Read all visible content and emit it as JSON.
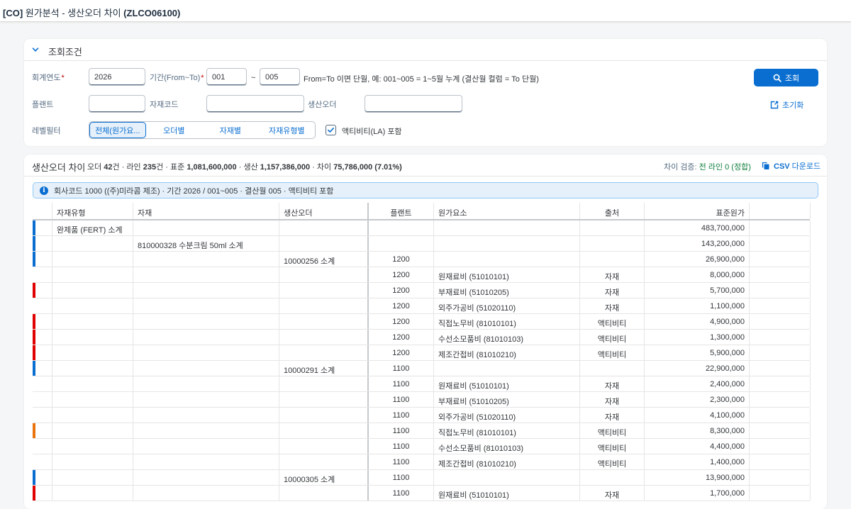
{
  "app": {
    "title_code": "[CO]",
    "title_text": " 원가분석 - 생산오더 차이 ",
    "title_tcode": "(ZLCO06100)"
  },
  "filters": {
    "title": "조회조건",
    "fiscal_year": {
      "label": "회계연도",
      "value": "2026"
    },
    "period": {
      "label": "기간(From~To)",
      "from": "001",
      "separator": "~",
      "to": "005",
      "hint": "From=To 이면 단월, 예: 001~005 = 1~5월 누계 (결산월 컬럼 = To 단월)"
    },
    "plant": {
      "label": "플랜트",
      "value": ""
    },
    "material_code": {
      "label": "자재코드",
      "value": ""
    },
    "production_order": {
      "label": "생산오더",
      "value": ""
    },
    "level_filter": {
      "label": "레벨필터",
      "options": [
        "전체(원가요...",
        "오더별",
        "자재별",
        "자재유형별"
      ],
      "selected": 0
    },
    "activity_checkbox": {
      "label": "액티비티(LA) 포함",
      "checked": true
    },
    "search_button": "조회",
    "reset_button": "초기화"
  },
  "results": {
    "title": "생산오더 차이",
    "summary": {
      "p1": "오더 ",
      "orders": "42",
      "p2": "건 · 라인 ",
      "lines": "235",
      "p3": "건 · 표준 ",
      "std": "1,081,600,000",
      "p4": " · 생산 ",
      "prod": "1,157,386,000",
      "p5": " · 차이 ",
      "diff": "75,786,000 (7.01%)"
    },
    "check": {
      "label": "차이 검증: ",
      "value": "전 라인 0 (정합)"
    },
    "csv": {
      "bold": "CSV",
      "rest": " 다운로드"
    },
    "info": "회사코드 1000 ((주)미라콤 제조) · 기간 2026 / 001~005 · 결산월 005 · 액티비티 포함"
  },
  "colors": {
    "blue": "#0a6ed1",
    "red": "#e00000",
    "orange": "#e9730c"
  },
  "table": {
    "headers": [
      "자재유형",
      "자재",
      "생산오더",
      "플랜트",
      "원가요소",
      "출처",
      "표준원가"
    ],
    "rows": [
      {
        "mark": "blue",
        "type": "완제품 (FERT) 소계",
        "material": "",
        "order": "",
        "plant": "",
        "element": "",
        "source": "",
        "std": "483,700,000"
      },
      {
        "mark": "blue",
        "type": "",
        "material": "810000328 수분크림 50ml 소계",
        "order": "",
        "plant": "",
        "element": "",
        "source": "",
        "std": "143,200,000"
      },
      {
        "mark": "blue",
        "type": "",
        "material": "",
        "order": "10000256 소계",
        "plant": "1200",
        "element": "",
        "source": "",
        "std": "26,900,000"
      },
      {
        "mark": "",
        "type": "",
        "material": "",
        "order": "",
        "plant": "1200",
        "element": "원재료비 (51010101)",
        "source": "자재",
        "std": "8,000,000"
      },
      {
        "mark": "red",
        "type": "",
        "material": "",
        "order": "",
        "plant": "1200",
        "element": "부재료비 (51010205)",
        "source": "자재",
        "std": "5,700,000"
      },
      {
        "mark": "",
        "type": "",
        "material": "",
        "order": "",
        "plant": "1200",
        "element": "외주가공비 (51020110)",
        "source": "자재",
        "std": "1,100,000"
      },
      {
        "mark": "red",
        "type": "",
        "material": "",
        "order": "",
        "plant": "1200",
        "element": "직접노무비 (81010101)",
        "source": "액티비티",
        "std": "4,900,000"
      },
      {
        "mark": "red",
        "type": "",
        "material": "",
        "order": "",
        "plant": "1200",
        "element": "수선소모품비 (81010103)",
        "source": "액티비티",
        "std": "1,300,000"
      },
      {
        "mark": "red",
        "type": "",
        "material": "",
        "order": "",
        "plant": "1200",
        "element": "제조간접비 (81010210)",
        "source": "액티비티",
        "std": "5,900,000"
      },
      {
        "mark": "blue",
        "type": "",
        "material": "",
        "order": "10000291 소계",
        "plant": "1100",
        "element": "",
        "source": "",
        "std": "22,900,000"
      },
      {
        "mark": "",
        "type": "",
        "material": "",
        "order": "",
        "plant": "1100",
        "element": "원재료비 (51010101)",
        "source": "자재",
        "std": "2,400,000"
      },
      {
        "mark": "",
        "type": "",
        "material": "",
        "order": "",
        "plant": "1100",
        "element": "부재료비 (51010205)",
        "source": "자재",
        "std": "2,300,000"
      },
      {
        "mark": "",
        "type": "",
        "material": "",
        "order": "",
        "plant": "1100",
        "element": "외주가공비 (51020110)",
        "source": "자재",
        "std": "4,100,000"
      },
      {
        "mark": "orange",
        "type": "",
        "material": "",
        "order": "",
        "plant": "1100",
        "element": "직접노무비 (81010101)",
        "source": "액티비티",
        "std": "8,300,000"
      },
      {
        "mark": "",
        "type": "",
        "material": "",
        "order": "",
        "plant": "1100",
        "element": "수선소모품비 (81010103)",
        "source": "액티비티",
        "std": "4,400,000"
      },
      {
        "mark": "",
        "type": "",
        "material": "",
        "order": "",
        "plant": "1100",
        "element": "제조간접비 (81010210)",
        "source": "액티비티",
        "std": "1,400,000"
      },
      {
        "mark": "blue",
        "type": "",
        "material": "",
        "order": "10000305 소계",
        "plant": "1100",
        "element": "",
        "source": "",
        "std": "13,900,000"
      },
      {
        "mark": "red",
        "type": "",
        "material": "",
        "order": "",
        "plant": "1100",
        "element": "원재료비 (51010101)",
        "source": "자재",
        "std": "1,700,000"
      }
    ]
  }
}
